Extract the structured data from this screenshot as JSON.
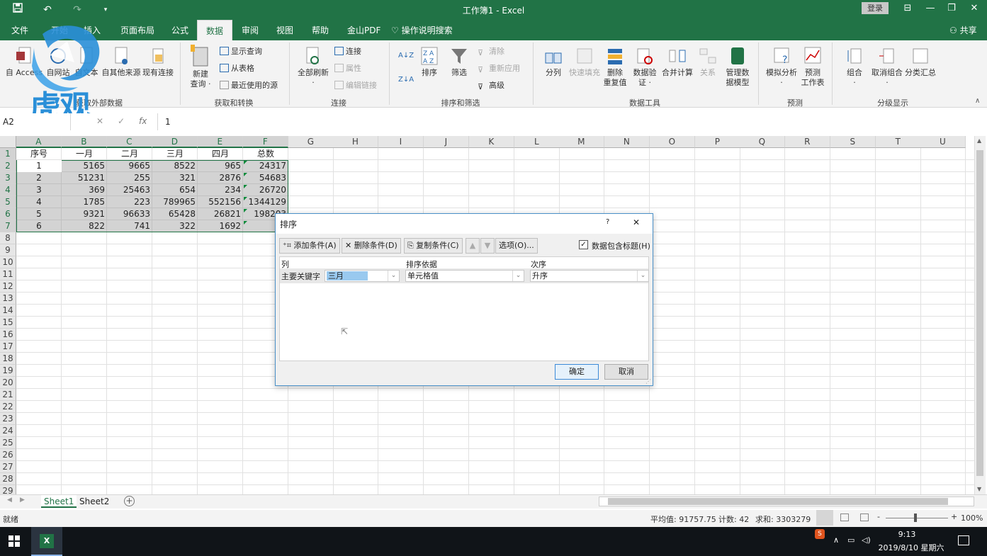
{
  "title_bar": {
    "window_title": "工作簿1 - Excel",
    "login_label": "登录",
    "minimize": "—",
    "restore": "❐",
    "close": "✕",
    "ribbon_display": "⊟"
  },
  "tabs": [
    {
      "label": "文件",
      "active": false
    },
    {
      "label": "开始",
      "active": false
    },
    {
      "label": "插入",
      "active": false
    },
    {
      "label": "页面布局",
      "active": false
    },
    {
      "label": "公式",
      "active": false
    },
    {
      "label": "数据",
      "active": true
    },
    {
      "label": "审阅",
      "active": false
    },
    {
      "label": "视图",
      "active": false
    },
    {
      "label": "帮助",
      "active": false
    },
    {
      "label": "金山PDF",
      "active": false
    }
  ],
  "tell_me": "操作说明搜索",
  "share_label": "共享",
  "ribbon": {
    "get_external": {
      "access": "自 Access",
      "web": "自网站",
      "text": "自文本",
      "other": "自其他来源",
      "existing": "现有连接",
      "group": "获取外部数据"
    },
    "transform": {
      "new_query_1": "新建",
      "new_query_2": "查询",
      "show_queries": "显示查询",
      "from_table": "从表格",
      "recent_sources": "最近使用的源",
      "group": "获取和转换"
    },
    "connections": {
      "refresh_all": "全部刷新",
      "connections": "连接",
      "properties": "属性",
      "edit_links": "编辑链接",
      "group": "连接"
    },
    "sort_filter": {
      "sort_az": "A↓Z",
      "sort_za": "Z↓A",
      "sort": "排序",
      "filter": "筛选",
      "clear": "清除",
      "reapply": "重新应用",
      "advanced": "高级",
      "group": "排序和筛选"
    },
    "data_tools": {
      "text_to_columns": "分列",
      "flash_fill": "快速填充",
      "remove_dup_1": "删除",
      "remove_dup_2": "重复值",
      "validation_1": "数据验",
      "validation_2": "证 ·",
      "consolidate": "合并计算",
      "relationships": "关系",
      "manage_model_1": "管理数",
      "manage_model_2": "据模型",
      "group": "数据工具"
    },
    "forecast": {
      "what_if": "模拟分析",
      "forecast_1": "预测",
      "forecast_2": "工作表",
      "group": "预测"
    },
    "outline": {
      "group_btn": "组合",
      "ungroup": "取消组合",
      "subtotal": "分类汇总",
      "group": "分级显示"
    }
  },
  "formula_bar": {
    "name_box": "A2",
    "fx": "fx",
    "value": "1",
    "cancel": "✕",
    "enter": "✓"
  },
  "sheet": {
    "columns": [
      "A",
      "B",
      "C",
      "D",
      "E",
      "F",
      "G",
      "H",
      "I",
      "J",
      "K",
      "L",
      "M",
      "N",
      "O",
      "P",
      "Q",
      "R",
      "S",
      "T",
      "U"
    ],
    "rows": [
      "1",
      "2",
      "3",
      "4",
      "5",
      "6",
      "7",
      "8",
      "9",
      "10",
      "11",
      "12",
      "13",
      "14",
      "15",
      "16",
      "17",
      "18",
      "19",
      "20",
      "21",
      "22",
      "23",
      "24",
      "25",
      "26",
      "27",
      "28",
      "29"
    ],
    "header_row": [
      "序号",
      "一月",
      "二月",
      "三月",
      "四月",
      "总数"
    ],
    "data_rows": [
      [
        "1",
        "5165",
        "9665",
        "8522",
        "965",
        "24317"
      ],
      [
        "2",
        "51231",
        "255",
        "321",
        "2876",
        "54683"
      ],
      [
        "3",
        "369",
        "25463",
        "654",
        "234",
        "26720"
      ],
      [
        "4",
        "1785",
        "223",
        "789965",
        "552156",
        "1344129"
      ],
      [
        "5",
        "9321",
        "96633",
        "65428",
        "26821",
        "198203"
      ],
      [
        "6",
        "822",
        "741",
        "322",
        "1692",
        "35"
      ]
    ]
  },
  "sheet_tabs": [
    "Sheet1",
    "Sheet2"
  ],
  "status": {
    "ready": "就绪",
    "average": "平均值: 91757.75",
    "count": "计数: 42",
    "sum": "求和: 3303279",
    "zoom": "100%",
    "minus": "-",
    "plus": "+"
  },
  "taskbar": {
    "time": "9:13",
    "date": "2019/8/10 星期六",
    "excel_icon": "X"
  },
  "watermark": "虎观",
  "dialog": {
    "title": "排序",
    "help": "?",
    "close": "✕",
    "add_level": "添加条件(A)",
    "delete_level": "删除条件(D)",
    "copy_level": "复制条件(C)",
    "options": "选项(O)...",
    "has_headers": "数据包含标题(H)",
    "has_headers_checked": true,
    "col_header": "列",
    "sort_on_header": "排序依据",
    "order_header": "次序",
    "row_label": "主要关键字",
    "column_value": "三月",
    "sort_on_value": "单元格值",
    "order_value": "升序",
    "ok": "确定",
    "cancel": "取消"
  }
}
